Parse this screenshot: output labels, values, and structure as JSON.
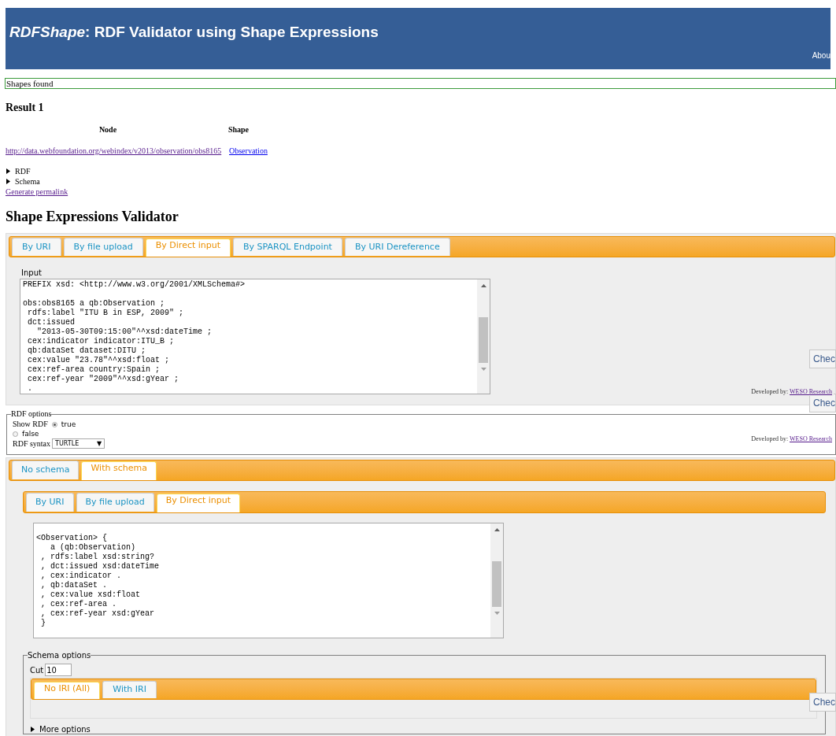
{
  "header": {
    "title_brand": "RDFShape",
    "title_rest": ": RDF Validator using Shape Expressions",
    "nav_link": "Abou"
  },
  "status": "Shapes found",
  "result": {
    "heading": "Result 1",
    "columns": [
      "Node",
      "Shape"
    ],
    "rows": [
      {
        "node": "http://data.webfoundation.org/webindex/v2013/observation/obs8165",
        "shape": "Observation"
      }
    ],
    "details": [
      {
        "label": "RDF",
        "expanded": false
      },
      {
        "label": "Schema",
        "expanded": false
      }
    ],
    "permalink": "Generate permalink"
  },
  "validator_heading": "Shape Expressions Validator",
  "data_tabs": [
    {
      "label": "By URI",
      "selected": false
    },
    {
      "label": "By file upload",
      "selected": false
    },
    {
      "label": "By Direct input",
      "selected": true
    },
    {
      "label": "By SPARQL Endpoint",
      "selected": false
    },
    {
      "label": "By URI Dereference",
      "selected": false
    }
  ],
  "input": {
    "label": "Input",
    "blocks": [
      [
        "PREFIX xsd: <http://www.w3.org/2001/XMLSchema#>"
      ],
      [
        "obs:obs8165 a qb:Observation ;",
        " rdfs:label \"ITU B in ESP, 2009\" ;",
        " dct:issued",
        "   \"2013-05-30T09:15:00\"^^xsd:dateTime ;",
        " cex:indicator indicator:ITU_B ;",
        " qb:dataSet dataset:DITU ;",
        " cex:value \"23.78\"^^xsd:float ;",
        " cex:ref-area country:Spain ;",
        " cex:ref-year \"2009\"^^xsd:gYear ;",
        " ."
      ]
    ]
  },
  "check_buttons": [
    "Chec",
    "Chec",
    "Chec"
  ],
  "credits": [
    {
      "text": "Developed by:",
      "link": "WESO Research"
    },
    {
      "text": "Developed by:",
      "link": "WESO Research"
    }
  ],
  "rdf_options": {
    "legend": "RDF options",
    "show_label": "Show RDF",
    "show_choices": [
      {
        "label": "true",
        "selected": true
      },
      {
        "label": "false",
        "selected": false
      }
    ],
    "syntax_label": "RDF syntax",
    "syntax_value": "TURTLE",
    "syntax_caret": "▼"
  },
  "schema_tabs": [
    {
      "label": "No schema",
      "selected": false
    },
    {
      "label": "With schema",
      "selected": true
    }
  ],
  "schema_source_tabs": [
    {
      "label": "By URI",
      "selected": false
    },
    {
      "label": "By file upload",
      "selected": false
    },
    {
      "label": "By Direct input",
      "selected": true
    }
  ],
  "schema_blocks": [
    [
      "<Observation> {",
      "   a (qb:Observation)",
      " , rdfs:label xsd:string?",
      " , dct:issued xsd:dateTime",
      " , cex:indicator .",
      " , qb:dataSet .",
      " , cex:value xsd:float",
      " , cex:ref-area .",
      " , cex:ref-year xsd:gYear",
      " }"
    ]
  ],
  "schema_options": {
    "legend": "Schema options",
    "cut_label": "Cut",
    "cut_value": "10",
    "iri_tabs": [
      {
        "label": "No IRI (All)",
        "selected": true
      },
      {
        "label": "With IRI",
        "selected": false
      }
    ],
    "more_options": {
      "label": "More options",
      "expanded": false
    }
  }
}
